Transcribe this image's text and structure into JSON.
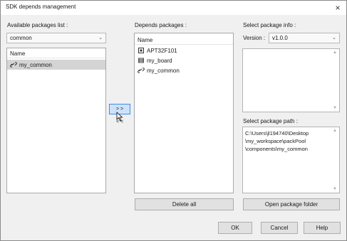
{
  "window": {
    "title": "SDK depends management",
    "close_glyph": "×"
  },
  "available": {
    "label": "Available packages list :",
    "combo_value": "common",
    "column_header": "Name",
    "items": [
      {
        "label": "my_common",
        "icon": "chain-link-icon",
        "selected": true
      }
    ]
  },
  "transfer": {
    "add_label": "> >",
    "remove_label": "< <"
  },
  "depends": {
    "label": "Depends packages :",
    "column_header": "Name",
    "items": [
      {
        "label": "APT32F101",
        "icon": "chip-icon"
      },
      {
        "label": "my_board",
        "icon": "board-icon"
      },
      {
        "label": "my_common",
        "icon": "chain-link-icon"
      }
    ],
    "delete_all_label": "Delete all"
  },
  "info": {
    "label": "Select package info :",
    "version_label": "Version :",
    "version_value": "v1.0.0",
    "path_label": "Select package path :",
    "path_lines": [
      "C:\\Users\\jl194740\\Desktop",
      "\\my_workspace\\packPool",
      "\\components\\my_common"
    ],
    "open_folder_label": "Open package folder"
  },
  "footer": {
    "ok_label": "OK",
    "cancel_label": "Cancel",
    "help_label": "Help"
  },
  "colors": {
    "selection": "#d4d4d4",
    "active_button": "#cce2fa",
    "active_border": "#3d8ee6",
    "window_bg": "#f0f0f0"
  }
}
